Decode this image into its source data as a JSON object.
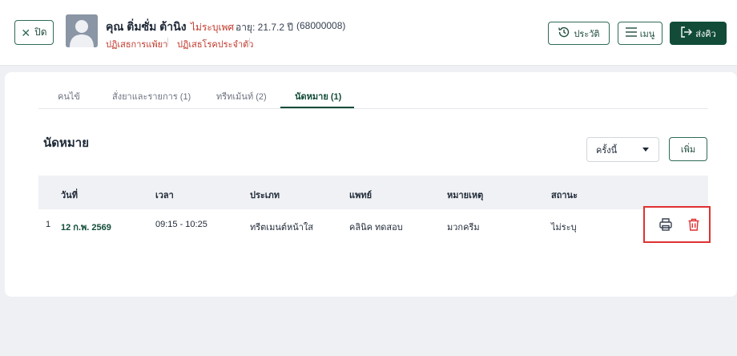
{
  "header": {
    "close_label": "ปิด",
    "patient_name": "คุณ ติ่มซั่ม ต้านิง",
    "sex": "ไม่ระบุเพศ",
    "age": "อายุ: 21.7.2 ปี",
    "hn": "(68000008)",
    "allergy_label": "ปฏิเสธการแพ้ยา",
    "disease_label": "ปฏิเสธโรคประจำตัว",
    "history_label": "ประวัติ",
    "menu_label": "เมนู",
    "send_label": "ส่งคิว"
  },
  "tabs": [
    {
      "label": "คนไข้"
    },
    {
      "label": "สั่งยาและรายการ (1)"
    },
    {
      "label": "ทรีทเม้นท์ (2)"
    },
    {
      "label": "นัดหมาย (1)",
      "active": true
    }
  ],
  "section": {
    "title": "นัดหมาย",
    "filter_value": "ครั้งนี้",
    "add_label": "เพิ่ม"
  },
  "table": {
    "headers": [
      "วันที่",
      "เวลา",
      "ประเภท",
      "แพทย์",
      "หมายเหตุ",
      "สถานะ"
    ],
    "rows": [
      {
        "index": "1",
        "date": "12 ก.พ. 2569",
        "time": "09:15 - 10:25",
        "type": "ทรีตเมนต์หน้าใส",
        "doctor": "คลินิค ทดสอบ",
        "note": "มวกครีม",
        "status": "ไม่ระบุ"
      }
    ]
  },
  "icons": {
    "close": "close-icon",
    "history": "history-icon",
    "menu": "hamburger-icon",
    "send": "send-queue-icon",
    "print": "printer-icon",
    "delete": "trash-icon"
  },
  "colors": {
    "brand": "#124c38",
    "danger": "#e03131",
    "warning_text": "#c0392b"
  }
}
